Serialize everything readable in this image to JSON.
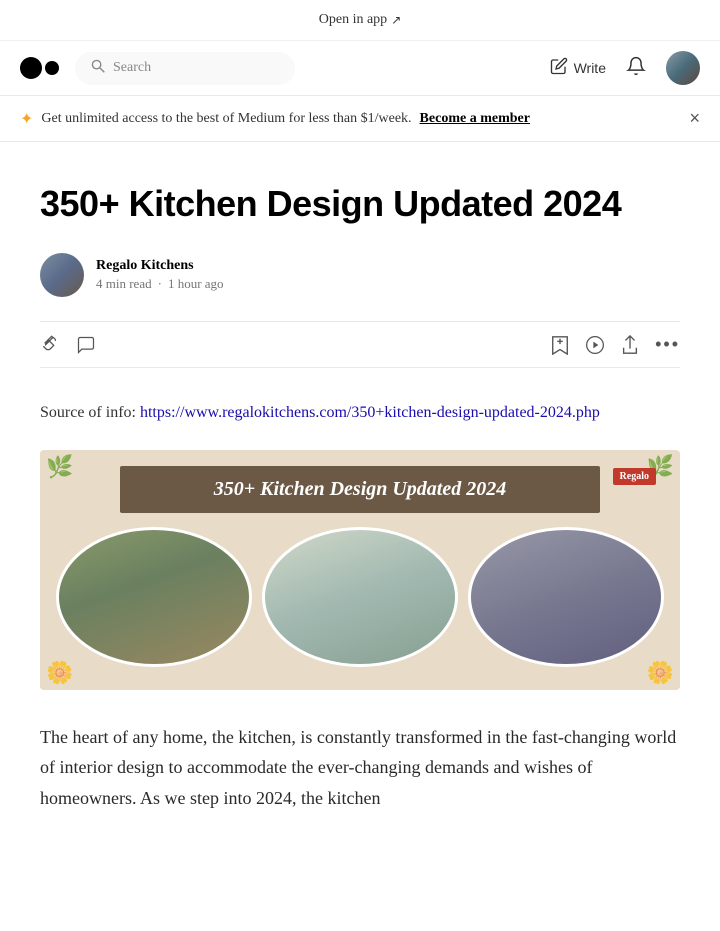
{
  "topbar": {
    "open_in_app": "Open in app"
  },
  "navbar": {
    "search_placeholder": "Search",
    "write_label": "Write",
    "logo_alt": "Medium logo"
  },
  "banner": {
    "star_icon": "✦",
    "text": "Get unlimited access to the best of Medium for less than $1/week.",
    "cta": "Become a member",
    "close_icon": "×"
  },
  "article": {
    "title": "350+ Kitchen Design Updated 2024",
    "author_name": "Regalo Kitchens",
    "read_time": "4 min read",
    "posted_time": "1 hour ago",
    "source_label": "Source of info:",
    "source_url": "https://www.regalokitchens.com/350+kitchen-design-updated-2024.php",
    "source_url_display": "https://www.regalokitchens.com/350+kitchen-design-updated-2024.php",
    "image_alt": "350+ Kitchen Design Updated 2024 banner",
    "image_title": "350+ Kitchen Design Updated 2024",
    "body_text": "The heart of any home, the kitchen, is constantly transformed in the fast-changing world of interior design to accommodate the ever-changing demands and wishes of homeowners. As we step into 2024, the kitchen"
  },
  "actions": {
    "clap_icon": "👏",
    "comment_icon": "💬",
    "bookmark_icon": "🔖",
    "listen_icon": "▶",
    "share_icon": "↑",
    "more_icon": "•••"
  }
}
